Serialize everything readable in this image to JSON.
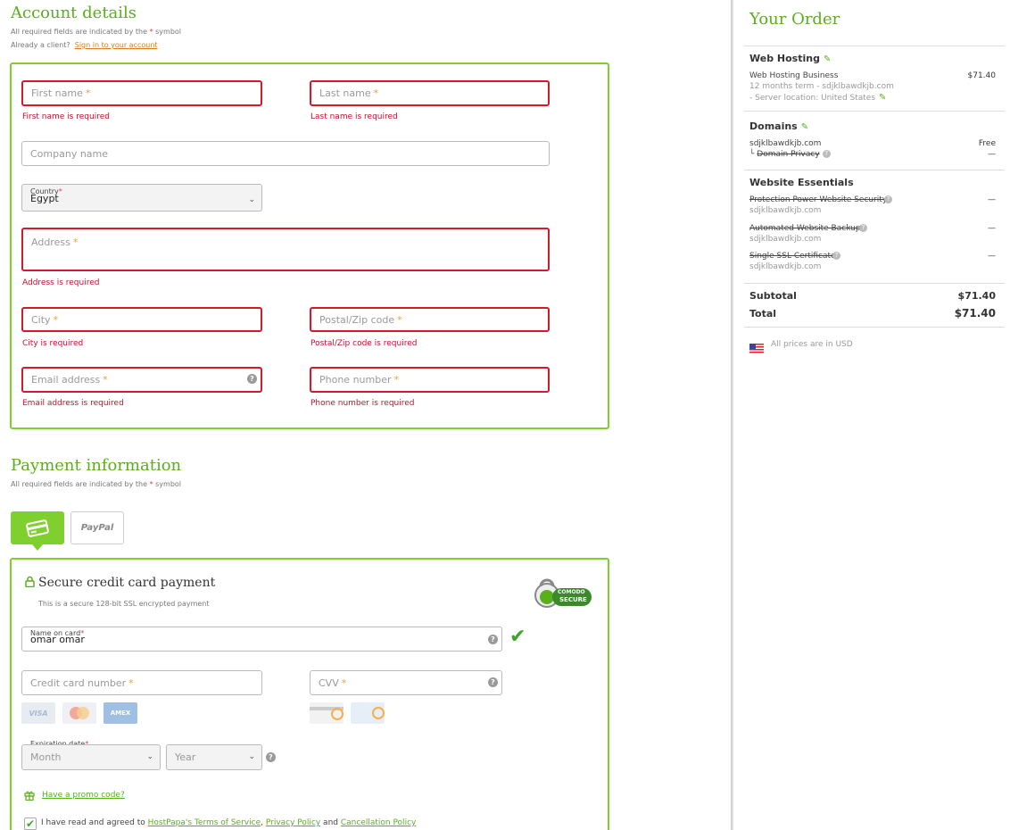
{
  "account": {
    "title": "Account details",
    "required_note_pre": "All required fields are indicated by the ",
    "required_star": "*",
    "required_note_post": " symbol",
    "already_client": "Already a client?",
    "signin_link": "Sign in to your account",
    "fields": {
      "first_name": {
        "placeholder": "First name",
        "error": "First name is required"
      },
      "last_name": {
        "placeholder": "Last name",
        "error": "Last name is required"
      },
      "company": {
        "placeholder": "Company name"
      },
      "country": {
        "label": "Country",
        "value": "Egypt"
      },
      "address": {
        "placeholder": "Address",
        "error": "Address is required"
      },
      "city": {
        "placeholder": "City",
        "error": "City is required"
      },
      "postal": {
        "placeholder": "Postal/Zip code",
        "error": "Postal/Zip code is required"
      },
      "email": {
        "placeholder": "Email address",
        "error": "Email address is required"
      },
      "phone": {
        "placeholder": "Phone number",
        "error": "Phone number is required"
      }
    }
  },
  "payment": {
    "title": "Payment information",
    "required_note_pre": "All required fields are indicated by the ",
    "required_star": "*",
    "required_note_post": " symbol",
    "tabs": {
      "paypal": "PayPal"
    },
    "secure_title": "Secure credit card payment",
    "secure_sub": "This is a secure 128-bit SSL encrypted payment",
    "badge_top": "COMODO",
    "badge_bottom": "SECURE",
    "name_on_card": {
      "label": "Name on card",
      "value": "omar omar"
    },
    "card_number": {
      "placeholder": "Credit card number"
    },
    "cvv": {
      "placeholder": "CVV"
    },
    "card_logos": {
      "visa": "VISA",
      "mc": "MC",
      "amex": "AMEX"
    },
    "expiration": {
      "label": "Expiration date",
      "month": "Month",
      "year": "Year"
    },
    "promo": "Have a promo code?",
    "terms_pre": "I have read and agreed to ",
    "terms_link1": "HostPapa's Terms of Service",
    "terms_sep": ", ",
    "terms_link2": "Privacy Policy",
    "terms_and": " and ",
    "terms_link3": "Cancellation Policy"
  },
  "order": {
    "title": "Your Order",
    "hosting": {
      "title": "Web Hosting",
      "line1": "Web Hosting Business",
      "line2": "12 months term - sdjklbawdkjb.com",
      "line3": "- Server location: United States",
      "price": "$71.40"
    },
    "domains": {
      "title": "Domains",
      "domain": "sdjklbawdkjb.com",
      "domain_price": "Free",
      "privacy": "Domain Privacy",
      "privacy_prefix": "└",
      "privacy_price": "—"
    },
    "essentials": {
      "title": "Website Essentials",
      "items": [
        {
          "name": "Protection Power Website Security",
          "domain": "sdjklbawdkjb.com",
          "price": "—"
        },
        {
          "name": "Automated Website Backup",
          "domain": "sdjklbawdkjb.com",
          "price": "—"
        },
        {
          "name": "Single SSL Certificate",
          "domain": "sdjklbawdkjb.com",
          "price": "—"
        }
      ]
    },
    "subtotal_label": "Subtotal",
    "subtotal": "$71.40",
    "total_label": "Total",
    "total": "$71.40",
    "currency_note": "All prices are in USD"
  },
  "colors": {
    "accent": "#5aaf1c",
    "panel_border": "#7fcf2f",
    "error": "#d11a2a",
    "link": "#e07a1a"
  }
}
